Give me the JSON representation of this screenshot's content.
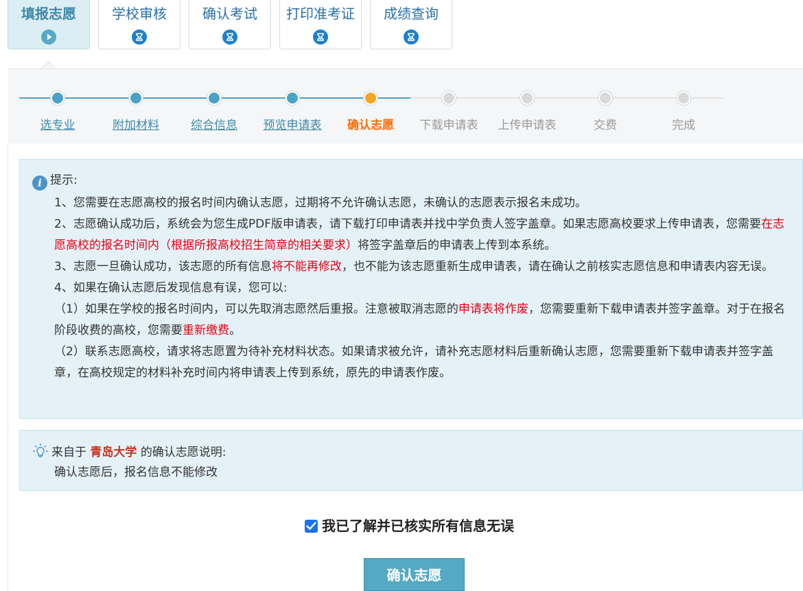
{
  "tabs": [
    {
      "label": "填报志愿",
      "icon": "play-icon",
      "active": true
    },
    {
      "label": "学校审核",
      "icon": "hourglass-icon",
      "active": false
    },
    {
      "label": "确认考试",
      "icon": "hourglass-icon",
      "active": false
    },
    {
      "label": "打印准考证",
      "icon": "hourglass-icon",
      "active": false
    },
    {
      "label": "成绩查询",
      "icon": "hourglass-icon",
      "active": false
    }
  ],
  "steps": [
    {
      "label": "选专业",
      "status": "done"
    },
    {
      "label": "附加材料",
      "status": "done"
    },
    {
      "label": "综合信息",
      "status": "done"
    },
    {
      "label": "预览申请表",
      "status": "done"
    },
    {
      "label": "确认志愿",
      "status": "current"
    },
    {
      "label": "下载申请表",
      "status": "todo"
    },
    {
      "label": "上传申请表",
      "status": "todo"
    },
    {
      "label": "交费",
      "status": "todo"
    },
    {
      "label": "完成",
      "status": "todo"
    }
  ],
  "colors": {
    "done": "#4aa3c4",
    "current": "#f5a623",
    "todo": "#d9d9d9",
    "highlight": "#e60012"
  },
  "notice": {
    "title": "提示:",
    "item1": "1、您需要在志愿高校的报名时间内确认志愿，过期将不允许确认志愿，未确认的志愿表示报名未成功。",
    "item2_a": "2、志愿确认成功后，系统会为您生成PDF版申请表，请下载打印申请表并找中学负责人签字盖章。如果志愿高校要求上传申请表，您需要",
    "item2_red": "在志愿高校的报名时间内（根据所报高校招生简章的相关要求）",
    "item2_b": "将签字盖章后的申请表上传到本系统。",
    "item3_a": "3、志愿一旦确认成功，该志愿的所有信息",
    "item3_red": "将不能再修改",
    "item3_b": "，也不能为该志愿重新生成申请表，请在确认之前核实志愿信息和申请表内容无误。",
    "item4": "4、如果在确认志愿后发现信息有误，您可以:",
    "item4_1_a": "（1）如果在学校的报名时间内，可以先取消志愿然后重报。注意被取消志愿的",
    "item4_1_red1": "申请表将作废",
    "item4_1_b": "，您需要重新下载申请表并签字盖章。对于在报名阶段收费的高校，您需要",
    "item4_1_red2": "重新缴费",
    "item4_1_c": "。",
    "item4_2": "（2）联系志愿高校，请求将志愿置为待补充材料状态。如果请求被允许，请补充志愿材料后重新确认志愿，您需要重新下载申请表并签字盖章，在高校规定的材料补充时间内将申请表上传到系统，原先的申请表作废。"
  },
  "school_note": {
    "prefix": "来自于",
    "school": "青岛大学",
    "suffix": "的确认志愿说明:",
    "text": "确认志愿后，报名信息不能修改"
  },
  "confirm": {
    "checked": true,
    "label": "我已了解并已核实所有信息无误",
    "button": "确认志愿"
  }
}
